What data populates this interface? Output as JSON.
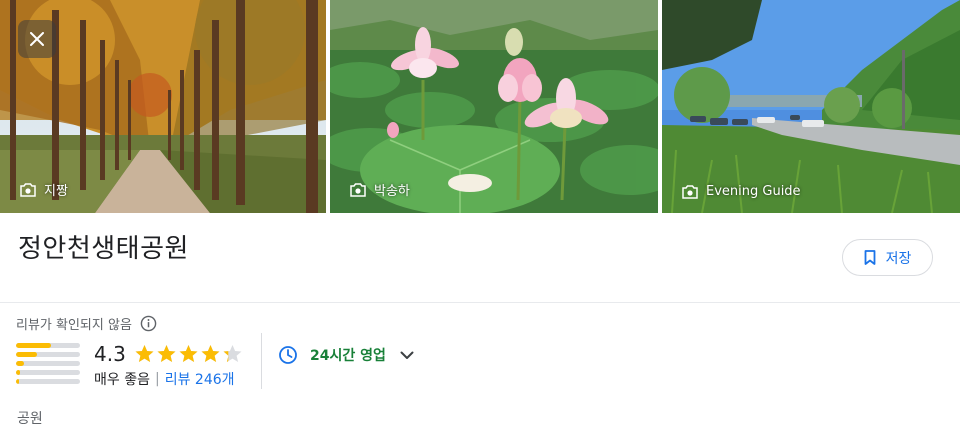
{
  "photos": [
    {
      "credit": "지짱"
    },
    {
      "credit": "박송하"
    },
    {
      "credit": "Evening Guide"
    }
  ],
  "place": {
    "name": "정안천생태공원",
    "save_label": "저장",
    "unverified_label": "리뷰가 확인되지 않음",
    "rating": "4.3",
    "rating_value": 4.3,
    "rating_desc": "매우 좋음",
    "separator": "|",
    "review_count": "리뷰 246개",
    "rating_distribution": [
      0.55,
      0.33,
      0.12,
      0.06,
      0.05
    ],
    "hours_label": "24시간 영업",
    "category": "공원"
  },
  "colors": {
    "accent": "#1a73e8",
    "open_green": "#188038",
    "star": "#fbbc04"
  },
  "icons": [
    "close-icon",
    "camera-icon",
    "bookmark-icon",
    "info-icon",
    "star-icon",
    "clock-icon",
    "chevron-down-icon"
  ]
}
